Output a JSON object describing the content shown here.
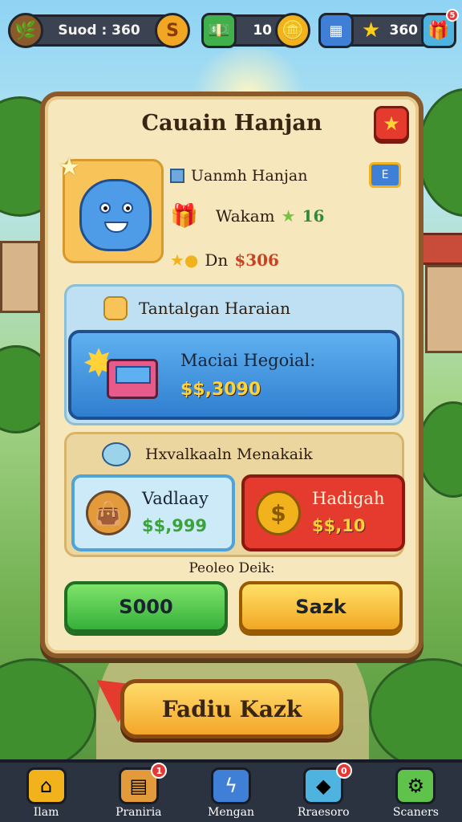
{
  "topbar": {
    "currency1": "Suod : 360",
    "currency1_icon": "S",
    "currency2": "10",
    "currency3": "360",
    "currency3_badge": "5"
  },
  "panel": {
    "title": "Cauain Hanjan",
    "close_icon": "★"
  },
  "profile": {
    "name": "Uanmh Hanjan",
    "badge": "E",
    "xp_label": "Wakam",
    "xp_value": "16",
    "coins_label": "Dn",
    "coins_value": "$306"
  },
  "daily": {
    "header": "Tantalgan Haraian",
    "card_title": "Maciai Hegoial:",
    "card_price": "$$,3090"
  },
  "offers": {
    "header": "Hxvalkaaln Menakaik",
    "left_title": "Vadlaay",
    "left_price": "$$,999",
    "right_title": "Hadigah",
    "right_price": "$$,10",
    "right_icon": "$"
  },
  "deal_label": "Peoleo Deik:",
  "buttons": {
    "green": "S000",
    "yellow": "Sazk",
    "big": "Fadiu Kazk"
  },
  "nav": [
    {
      "label": "Ilam",
      "badge": ""
    },
    {
      "label": "Praniria",
      "badge": "1"
    },
    {
      "label": "Mengan",
      "badge": ""
    },
    {
      "label": "Rraesoro",
      "badge": "0"
    },
    {
      "label": "Scaners",
      "badge": ""
    }
  ],
  "colors": {
    "panel_bg": "#f6e7bd",
    "panel_border": "#8a5a2b",
    "blue_card": "#2f7fd0",
    "red_offer": "#e53a2e",
    "green_button": "#36b03a",
    "yellow_button": "#f2a724"
  }
}
